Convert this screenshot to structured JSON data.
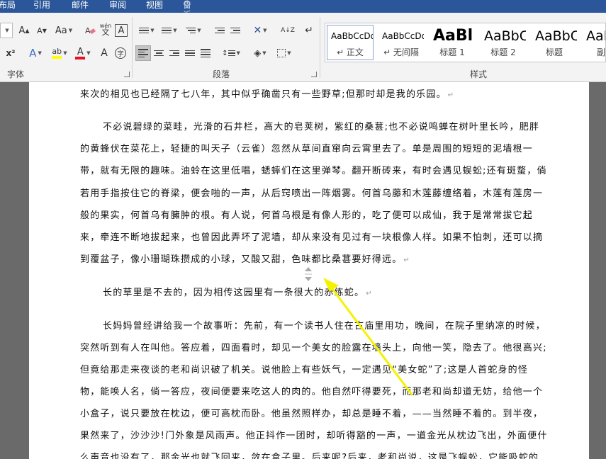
{
  "menu": {
    "items": [
      "布局",
      "引用",
      "邮件",
      "审阅",
      "视图"
    ],
    "tell_me": "告诉我你想要做什么"
  },
  "ribbon": {
    "font_group_label": "字体",
    "paragraph_group_label": "段落",
    "styles_group_label": "样式",
    "font_buttons": {
      "grow": "A",
      "shrink": "A",
      "case": "Aa",
      "phonetic": "wén",
      "border_char": "A",
      "superscript": "x²",
      "effects": "A",
      "highlight": "ab",
      "font_color": "A",
      "char_shading": "A",
      "enclose": "字"
    },
    "paragraph_buttons": {
      "sort": "A↓Z",
      "marks": "↵"
    },
    "styles": [
      {
        "sample": "AaBbCcDd",
        "name": "↵ 正文"
      },
      {
        "sample": "AaBbCcDd",
        "name": "↵ 无间隔"
      },
      {
        "sample": "AaBl",
        "name": "标题 1"
      },
      {
        "sample": "AaBbC",
        "name": "标题 2"
      },
      {
        "sample": "AaBbC",
        "name": "标题"
      },
      {
        "sample": "AaB",
        "name": "副标"
      }
    ]
  },
  "document": {
    "lines": [
      "来次的相见也已经隔了七八年，其中似乎确凿只有一些野草;但那时却是我的乐园。",
      "不必说碧绿的菜畦，光滑的石井栏，高大的皂荚树，紫红的桑葚;也不必说鸣蝉在树叶里长吟，肥胖",
      "的黄蜂伏在菜花上，轻捷的叫天子（云雀）忽然从草间直窜向云霄里去了。单是周围的短短的泥墙根一",
      "带，就有无限的趣味。油蛉在这里低唱，蟋蟀们在这里弹琴。翻开断砖来，有时会遇见蜈蚣;还有斑蝥，倘",
      "若用手指按住它的脊梁，便会啪的一声，从后窍喷出一阵烟雾。何首乌藤和木莲藤缠络着，木莲有莲房一",
      "般的果实，何首乌有臃肿的根。有人说，何首乌根是有像人形的，吃了便可以成仙，我于是常常拔它起",
      "来，牵连不断地拔起来，也曾因此弄坏了泥墙，却从来没有见过有一块根像人样。如果不怕刺，还可以摘",
      "到覆盆子，像小珊瑚珠攒成的小球，又酸又甜，色味都比桑葚要好得远。",
      "长的草里是不去的，因为相传这园里有一条很大的赤练蛇。",
      "长妈妈曾经讲给我一个故事听：先前，有一个读书人住在古庙里用功，晚间，在院子里纳凉的时候，",
      "突然听到有人在叫他。答应着，四面看时，却见一个美女的脸露在墙头上，向他一笑，隐去了。他很高兴;",
      "但竟给那走来夜谈的老和尚识破了机关。说他脸上有些妖气，一定遇见“美女蛇”了;这是人首蛇身的怪",
      "物，能唤人名，倘一答应，夜间便要来吃这人的肉的。他自然吓得要死，而那老和尚却道无妨，给他一个",
      "小盒子，说只要放在枕边，便可高枕而卧。他虽然照样办，却总是睡不着，——当然睡不着的。到半夜，",
      "果然来了，沙沙沙!门外象是风雨声。他正抖作一团时，却听得豁的一声，一道金光从枕边飞出，外面便什",
      "么声音也没有了，那金光也就飞回来，敛在盒子里。后来呢?后来，老和尚说，这是飞蜈蚣，它能吸蛇的"
    ],
    "para_mark": "↵"
  },
  "colors": {
    "title_bar": "#2b579a",
    "ribbon_bg": "#f3f3f3",
    "highlight_yellow": "#ffff00",
    "font_red": "#e81123",
    "annotation_arrow": "#f5f200"
  }
}
